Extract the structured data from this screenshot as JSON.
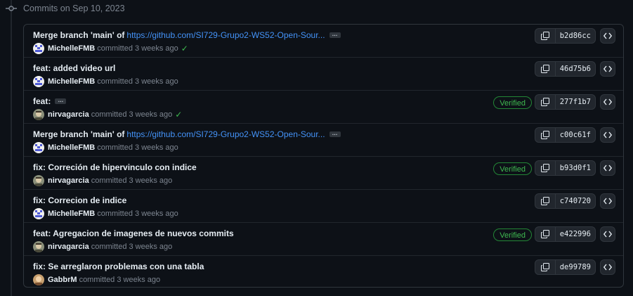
{
  "day_label": "Commits on Sep 10, 2023",
  "verified_label": "Verified",
  "commits": [
    {
      "title": "Merge branch 'main' of ",
      "link": "https://github.com/SI729-Grupo2-WS52-Open-Sour...",
      "has_ellipsis": true,
      "author": "MichelleFMB",
      "when": "committed 3 weeks ago",
      "check": true,
      "verified": false,
      "sha": "b2d86cc",
      "avatar": "michelle"
    },
    {
      "title": "feat: added video url",
      "link": "",
      "has_ellipsis": false,
      "author": "MichelleFMB",
      "when": "committed 3 weeks ago",
      "check": false,
      "verified": false,
      "sha": "46d75b6",
      "avatar": "michelle"
    },
    {
      "title": "feat:",
      "link": "",
      "has_ellipsis": true,
      "author": "nirvagarcia",
      "when": "committed 3 weeks ago",
      "check": true,
      "verified": true,
      "sha": "277f1b7",
      "avatar": "nirva"
    },
    {
      "title": "Merge branch 'main' of ",
      "link": "https://github.com/SI729-Grupo2-WS52-Open-Sour...",
      "has_ellipsis": true,
      "author": "MichelleFMB",
      "when": "committed 3 weeks ago",
      "check": false,
      "verified": false,
      "sha": "c00c61f",
      "avatar": "michelle"
    },
    {
      "title": "fix: Correción de hipervinculo con indice",
      "link": "",
      "has_ellipsis": false,
      "author": "nirvagarcia",
      "when": "committed 3 weeks ago",
      "check": false,
      "verified": true,
      "sha": "b93d0f1",
      "avatar": "nirva"
    },
    {
      "title": "fix: Correcion de indice",
      "link": "",
      "has_ellipsis": false,
      "author": "MichelleFMB",
      "when": "committed 3 weeks ago",
      "check": false,
      "verified": false,
      "sha": "c740720",
      "avatar": "michelle"
    },
    {
      "title": "feat: Agregacion de imagenes de nuevos commits",
      "link": "",
      "has_ellipsis": false,
      "author": "nirvagarcia",
      "when": "committed 3 weeks ago",
      "check": false,
      "verified": true,
      "sha": "e422996",
      "avatar": "nirva"
    },
    {
      "title": "fix: Se arreglaron problemas con una tabla",
      "link": "",
      "has_ellipsis": false,
      "author": "GabbrM",
      "when": "committed 3 weeks ago",
      "check": false,
      "verified": false,
      "sha": "de99789",
      "avatar": "gabbr"
    }
  ],
  "icons": {
    "commit": "git-commit-icon",
    "copy": "copy-icon",
    "browse": "code-icon",
    "check": "check-icon"
  },
  "colors": {
    "background": "#0d1117",
    "link": "#4493f8",
    "verified": "#3fb950",
    "border": "#30363d"
  }
}
